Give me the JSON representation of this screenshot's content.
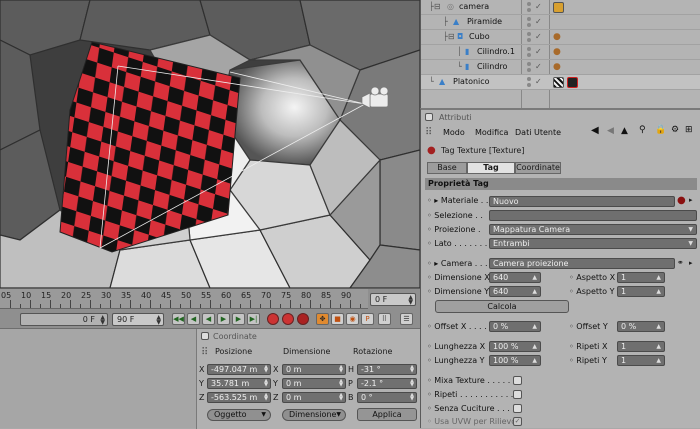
{
  "viewport": {
    "label": "3D viewport"
  },
  "timeline": {
    "ticks": [
      "05",
      "10",
      "15",
      "20",
      "25",
      "30",
      "35",
      "40",
      "45",
      "50",
      "55",
      "60",
      "65",
      "70",
      "75",
      "80",
      "85",
      "90"
    ],
    "current_frame": "0 F",
    "start_frame": "0 F",
    "end_frame": "90 F",
    "play_prev": "◀◀",
    "play_back": "◀",
    "play_fwd": "▶",
    "play_next": "▶▶",
    "play_end": "▶|"
  },
  "coordinates": {
    "header": "Coordinate",
    "col_position": "Posizione",
    "col_size": "Dimensione",
    "col_rotation": "Rotazione",
    "rows": [
      {
        "axis": "X",
        "pos": "-497.047 m",
        "size_axis": "X",
        "size": "0 m",
        "rot_axis": "H",
        "rot": "-31 °"
      },
      {
        "axis": "Y",
        "pos": "35.781 m",
        "size_axis": "Y",
        "size": "0 m",
        "rot_axis": "P",
        "rot": "-2.1 °"
      },
      {
        "axis": "Z",
        "pos": "-563.525 m",
        "size_axis": "Z",
        "size": "0 m",
        "rot_axis": "B",
        "rot": "0 °"
      }
    ],
    "mode_dropdown": "Oggetto",
    "size_dropdown": "Dimensione",
    "apply_button": "Applica"
  },
  "objects": {
    "rows": [
      {
        "name": "camera",
        "indent": 0
      },
      {
        "name": "Piramide",
        "indent": 1
      },
      {
        "name": "Cubo",
        "indent": 1
      },
      {
        "name": "Cilindro.1",
        "indent": 2
      },
      {
        "name": "Cilindro",
        "indent": 2
      },
      {
        "name": "Platonico",
        "indent": 0
      }
    ]
  },
  "attributes": {
    "header": "Attributi",
    "menu": [
      "Modo",
      "Modifica",
      "Dati Utente"
    ],
    "tag_title": "Tag Texture [Texture]",
    "tabs": [
      "Base",
      "Tag",
      "Coordinate"
    ],
    "active_tab": "Tag",
    "section": "Proprietà Tag",
    "material_label": "Materiale . .",
    "material_value": "Nuovo",
    "selection_label": "Selezione . .",
    "selection_value": "",
    "projection_label": "Proiezione .",
    "projection_value": "Mappatura Camera",
    "side_label": "Lato . . . . . . .",
    "side_value": "Entrambi",
    "camera_label": "Camera . . .",
    "camera_value": "Camera proiezione",
    "dimx_label": "Dimensione X",
    "dimx_value": "640",
    "dimy_label": "Dimensione Y",
    "dimy_value": "640",
    "aspx_label": "Aspetto X",
    "aspx_value": "1",
    "aspy_label": "Aspetto Y",
    "aspy_value": "1",
    "calc_button": "Calcola",
    "offx_label": "Offset X . . . .",
    "offx_value": "0 %",
    "offy_label": "Offset Y",
    "offy_value": "0 %",
    "lenx_label": "Lunghezza X",
    "lenx_value": "100 %",
    "leny_label": "Lunghezza Y",
    "leny_value": "100 %",
    "repx_label": "Ripeti X",
    "repx_value": "1",
    "repy_label": "Ripeti Y",
    "repy_value": "1",
    "mix_label": "Mixa Texture . . . . . .",
    "repeat_label": "Ripeti . . . . . . . . . . .",
    "seamless_label": "Senza Cuciture . . . .",
    "uvw_label": "Usa UVW per Rilievo"
  }
}
